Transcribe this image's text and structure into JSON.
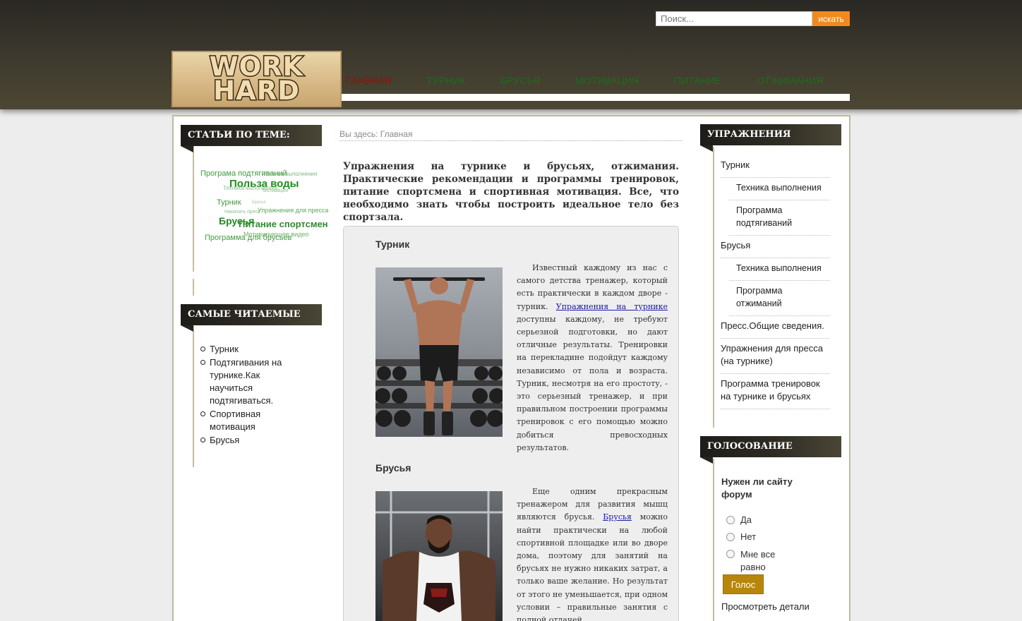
{
  "search": {
    "placeholder": "Поиск...",
    "button": "искать"
  },
  "logo": {
    "line1": "WORK",
    "line2": "HARD"
  },
  "nav": [
    {
      "label": "ГЛАВНАЯ",
      "active": true
    },
    {
      "label": "ТУРНИК"
    },
    {
      "label": "БРУСЬЯ"
    },
    {
      "label": "МОТИВАЦИЯ"
    },
    {
      "label": "ПИТАНИЕ"
    },
    {
      "label": "ОТЖИМАНИЯ"
    }
  ],
  "left": {
    "related_title": "СТАТЬИ ПО ТЕМЕ:",
    "cloud": [
      "Програма подтягиваний",
      "Техника выполнения",
      "Польза воды",
      "Техника выполнения",
      "Мотивация",
      "Турник",
      "Брусья",
      "Накачать пресс",
      "Упражнения для пресса",
      "Брусья",
      "Питание спортсмена",
      "Мотивирующее видео",
      "Программа для брусьев"
    ],
    "popular_title": "САМЫЕ ЧИТАЕМЫЕ",
    "popular": [
      "Турник",
      "Подтягивания на турнике.Как научиться подтягиваться.",
      "Спортивная мотивация",
      "Брусья"
    ]
  },
  "main": {
    "breadcrumb": "Вы здесь: Главная",
    "intro": "Упражнения на турнике и брусьях, отжимания. Практические рекомендации и программы тренировок, питание спортсмена и спортивная мотивация. Все, что необходимо знать чтобы построить идеальное тело без спортзала.",
    "sections": [
      {
        "title": "Турник",
        "text_before": "Известный каждому из нас с самого детства тренажер, который есть практически в каждом дворе - турник. ",
        "link": "Упражнения на турнике",
        "text_after": " доступны каждому, не требуют серьезной подготовки, но дают отличные результаты. Тренировки на перекладине подойдут каждому независимо от пола и возраста. Турник, несмотря на его простоту, - это серьезный тренажер, и при правильном построении программы тренировок с его помощью можно добиться превосходных результатов."
      },
      {
        "title": "Брусья",
        "text_before": "Еще одним прекрасным тренажером для развития мышц являются брусья. ",
        "link": "Брусья",
        "text_after": " можно найти практически на любой спортивной площадке или во дворе дома, поэтому для занятий на брусьях не нужно никаких затрат, а только ваше желание. Но результат от этого не уменьшается, при одном условии – правильные занятия с полной отдачей."
      }
    ]
  },
  "right": {
    "exercises_title": "УПРАЖНЕНИЯ",
    "exercises": [
      {
        "label": "Турник"
      },
      {
        "label": "Техника выполнения",
        "sub": true
      },
      {
        "label": "Программа подтягиваний",
        "sub": true
      },
      {
        "label": "Брусья"
      },
      {
        "label": "Техника выполнения",
        "sub": true
      },
      {
        "label": "Программа отжиманий",
        "sub": true
      },
      {
        "label": "Пресс.Общие сведения."
      },
      {
        "label": "Упражнения для пресса (на турнике)"
      },
      {
        "label": "Программа тренировок на турнике и брусьях"
      }
    ],
    "poll_title": "ГОЛОСОВАНИЕ",
    "poll_question": "Нужен ли сайту форум",
    "poll_options": [
      "Да",
      "Нет",
      "Мне все равно"
    ],
    "vote_button": "Голос",
    "details_link": "Просмотреть детали"
  }
}
